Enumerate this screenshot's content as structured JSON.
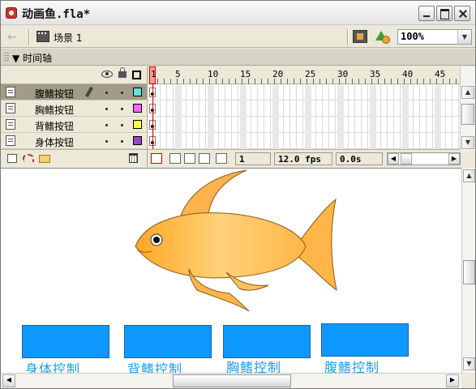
{
  "window": {
    "title": "动画鱼.fla*"
  },
  "toolbar": {
    "scene_label": "场景 1",
    "zoom": "100%"
  },
  "timeline": {
    "header": "时间轴",
    "ruler": [
      "1",
      "5",
      "10",
      "15",
      "20",
      "25",
      "30",
      "35",
      "40",
      "45"
    ],
    "layers": [
      {
        "name": "腹鳍按钮",
        "color": "#66e0e0",
        "selected": true
      },
      {
        "name": "胸鳍按钮",
        "color": "#ff66ff",
        "selected": false
      },
      {
        "name": "背鳍按钮",
        "color": "#ffff44",
        "selected": false
      },
      {
        "name": "身体按钮",
        "color": "#9944cc",
        "selected": false
      }
    ],
    "current_frame": "1",
    "frame_rate": "12.0 fps",
    "elapsed": "0.0s"
  },
  "stage": {
    "buttons": [
      {
        "label": "身体控制",
        "color": "#0d99ff"
      },
      {
        "label": "背鳍控制",
        "color": "#0d99ff"
      },
      {
        "label": "胸鳍控制",
        "color": "#0d99ff"
      },
      {
        "label": "腹鳍控制",
        "color": "#0d99ff"
      }
    ]
  }
}
